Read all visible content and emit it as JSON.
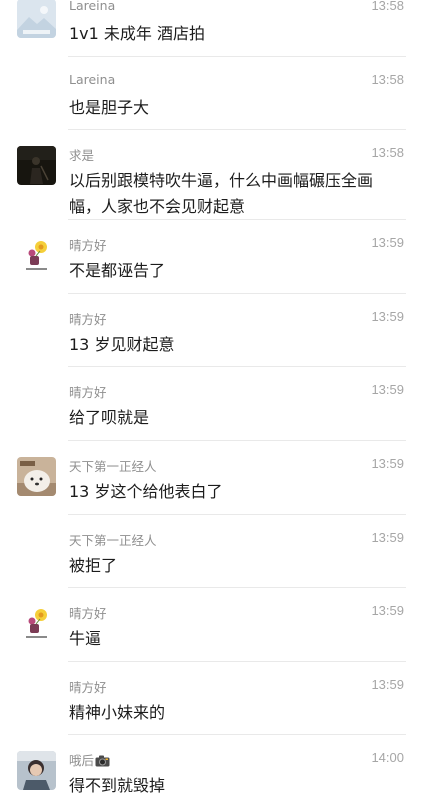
{
  "messages": [
    {
      "sender": "Lareina",
      "time": "13:58",
      "text": "1v1 未成年 酒店拍",
      "avatar_icon": "landscape-placeholder-avatar"
    },
    {
      "sender": "Lareina",
      "time": "13:58",
      "text": "也是胆子大",
      "avatar_icon": ""
    },
    {
      "sender": "求是",
      "time": "13:58",
      "text": "以后别跟模特吹牛逼，什么中画幅碾压全画幅，人家也不会见财起意",
      "avatar_icon": "dark-figure-avatar"
    },
    {
      "sender": "晴方好",
      "time": "13:59",
      "text": "不是都诬告了",
      "avatar_icon": "flower-sticker-avatar"
    },
    {
      "sender": "晴方好",
      "time": "13:59",
      "text": "13 岁见财起意",
      "avatar_icon": ""
    },
    {
      "sender": "晴方好",
      "time": "13:59",
      "text": "给了呗就是",
      "avatar_icon": ""
    },
    {
      "sender": "天下第一正经人",
      "time": "13:59",
      "text": "13 岁这个给他表白了",
      "avatar_icon": "dog-photo-avatar"
    },
    {
      "sender": "天下第一正经人",
      "time": "13:59",
      "text": "被拒了",
      "avatar_icon": ""
    },
    {
      "sender": "晴方好",
      "time": "13:59",
      "text": "牛逼",
      "avatar_icon": "flower-sticker-avatar"
    },
    {
      "sender": "晴方好",
      "time": "13:59",
      "text": "精神小妹来的",
      "avatar_icon": ""
    },
    {
      "sender": "哦后",
      "time": "14:00",
      "text": "得不到就毁掉",
      "avatar_icon": "person-photo-avatar",
      "sender_icon": "camera-emoji-icon"
    }
  ]
}
